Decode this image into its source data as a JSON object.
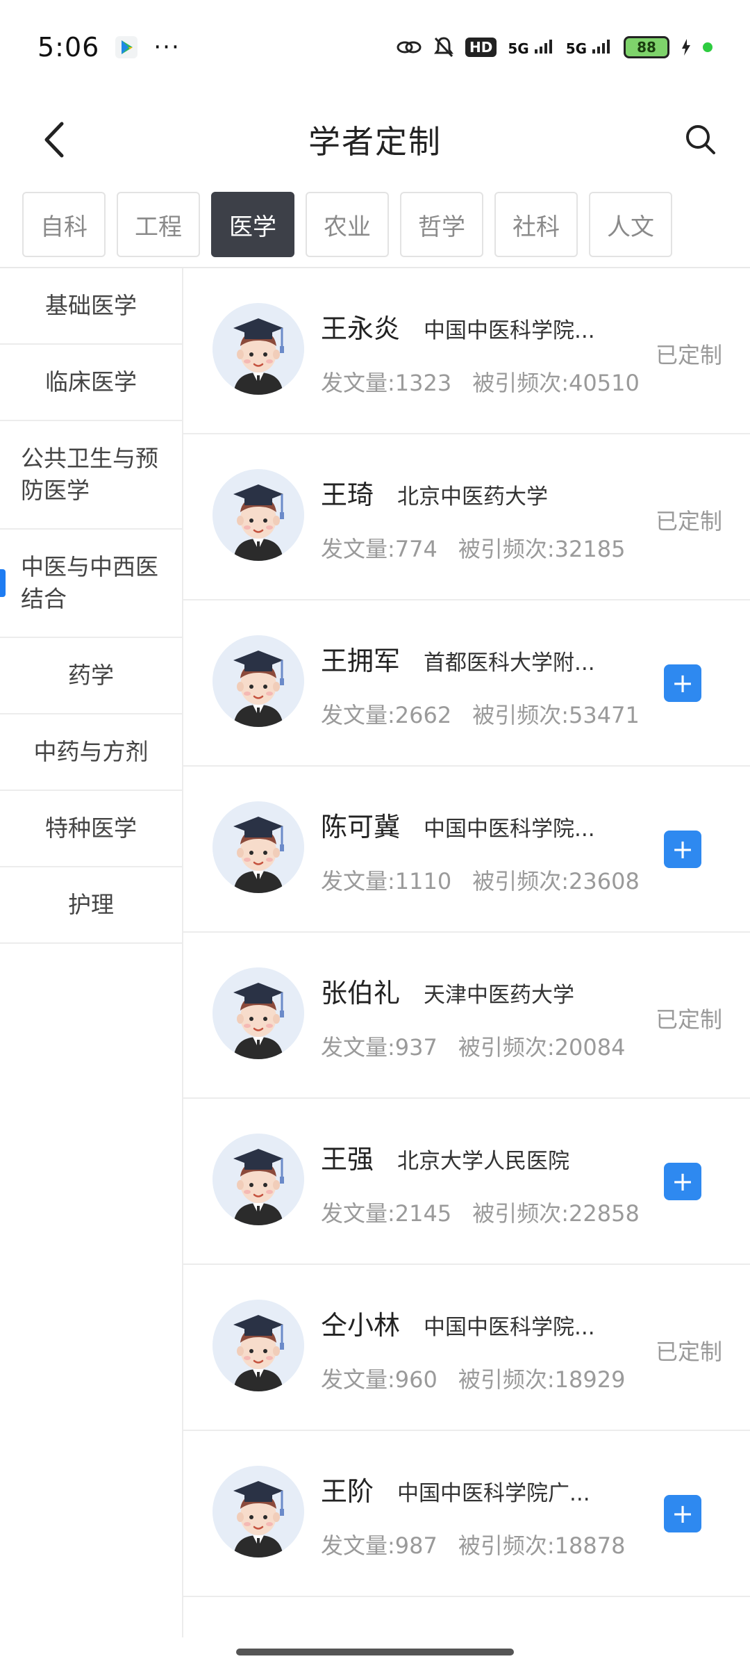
{
  "status_bar": {
    "time": "5:06",
    "more": "···",
    "hd_label": "HD",
    "signal_1": "5G",
    "signal_2": "5G",
    "battery": "88"
  },
  "header": {
    "title": "学者定制",
    "back_icon": "chevron-left-icon",
    "search_icon": "search-icon"
  },
  "tabs": [
    {
      "label": "自科",
      "active": false
    },
    {
      "label": "工程",
      "active": false
    },
    {
      "label": "医学",
      "active": true
    },
    {
      "label": "农业",
      "active": false
    },
    {
      "label": "哲学",
      "active": false
    },
    {
      "label": "社科",
      "active": false
    },
    {
      "label": "人文",
      "active": false
    }
  ],
  "sidebar": {
    "items": [
      {
        "label": "基础医学"
      },
      {
        "label": "临床医学"
      },
      {
        "label": "公共卫生与预防医学"
      },
      {
        "label": "中医与中西医结合",
        "active": true
      },
      {
        "label": "药学"
      },
      {
        "label": "中药与方剂"
      },
      {
        "label": "特种医学"
      },
      {
        "label": "护理"
      }
    ]
  },
  "scholars": [
    {
      "name": "王永炎",
      "institution": "中国中医科学院...",
      "papers": "发文量:1323",
      "citations": "被引频次:40510",
      "status": "已定制"
    },
    {
      "name": "王琦",
      "institution": "北京中医药大学",
      "papers": "发文量:774",
      "citations": "被引频次:32185",
      "status": "已定制"
    },
    {
      "name": "王拥军",
      "institution": "首都医科大学附...",
      "papers": "发文量:2662",
      "citations": "被引频次:53471",
      "status": "+"
    },
    {
      "name": "陈可冀",
      "institution": "中国中医科学院...",
      "papers": "发文量:1110",
      "citations": "被引频次:23608",
      "status": "+"
    },
    {
      "name": "张伯礼",
      "institution": "天津中医药大学",
      "papers": "发文量:937",
      "citations": "被引频次:20084",
      "status": "已定制"
    },
    {
      "name": "王强",
      "institution": "北京大学人民医院",
      "papers": "发文量:2145",
      "citations": "被引频次:22858",
      "status": "+"
    },
    {
      "name": "仝小林",
      "institution": "中国中医科学院...",
      "papers": "发文量:960",
      "citations": "被引频次:18929",
      "status": "已定制"
    },
    {
      "name": "王阶",
      "institution": "中国中医科学院广...",
      "papers": "发文量:987",
      "citations": "被引频次:18878",
      "status": "+"
    }
  ],
  "colors": {
    "accent": "#2e89f0",
    "tab_active_bg": "#3d4048",
    "indicator": "#1e7cf2"
  }
}
